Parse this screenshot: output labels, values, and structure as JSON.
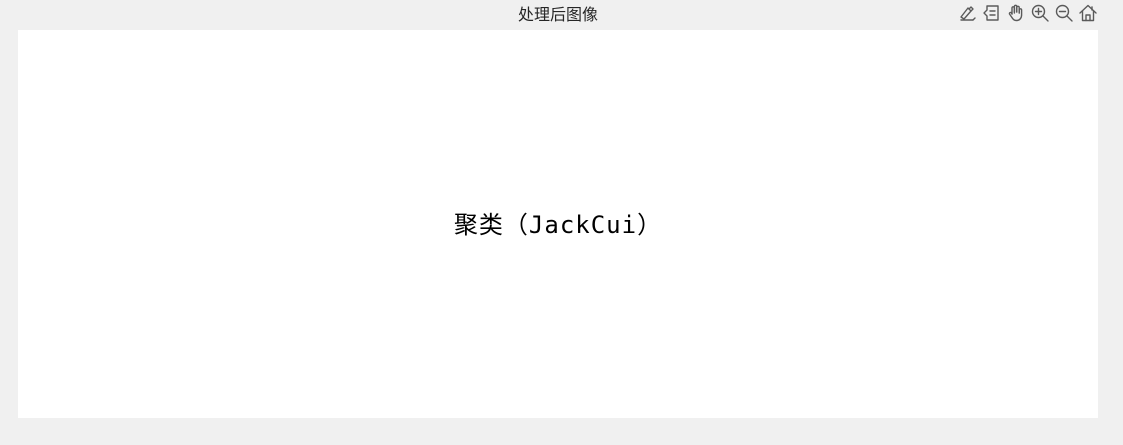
{
  "figure": {
    "title": "处理后图像"
  },
  "toolbar": {
    "buttons": [
      {
        "name": "brush-icon"
      },
      {
        "name": "datatip-icon"
      },
      {
        "name": "pan-hand-icon"
      },
      {
        "name": "zoom-in-icon"
      },
      {
        "name": "zoom-out-icon"
      },
      {
        "name": "home-icon"
      }
    ]
  },
  "image": {
    "text": "聚类（JackCui）"
  }
}
